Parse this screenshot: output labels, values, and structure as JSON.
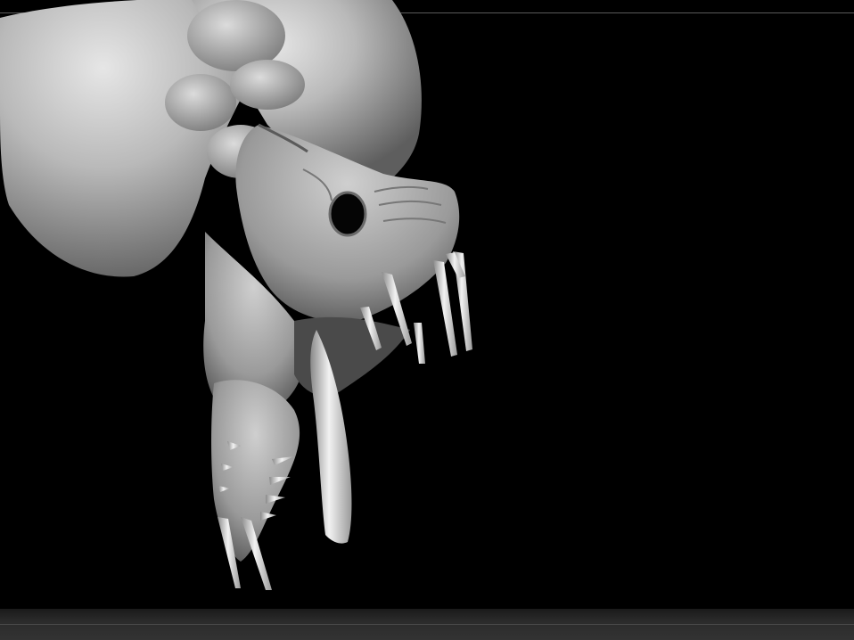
{
  "app": {
    "viewport_background": "#000000",
    "model_color": "#a8a8a8",
    "model_icon": "sculpted-creature-head"
  }
}
